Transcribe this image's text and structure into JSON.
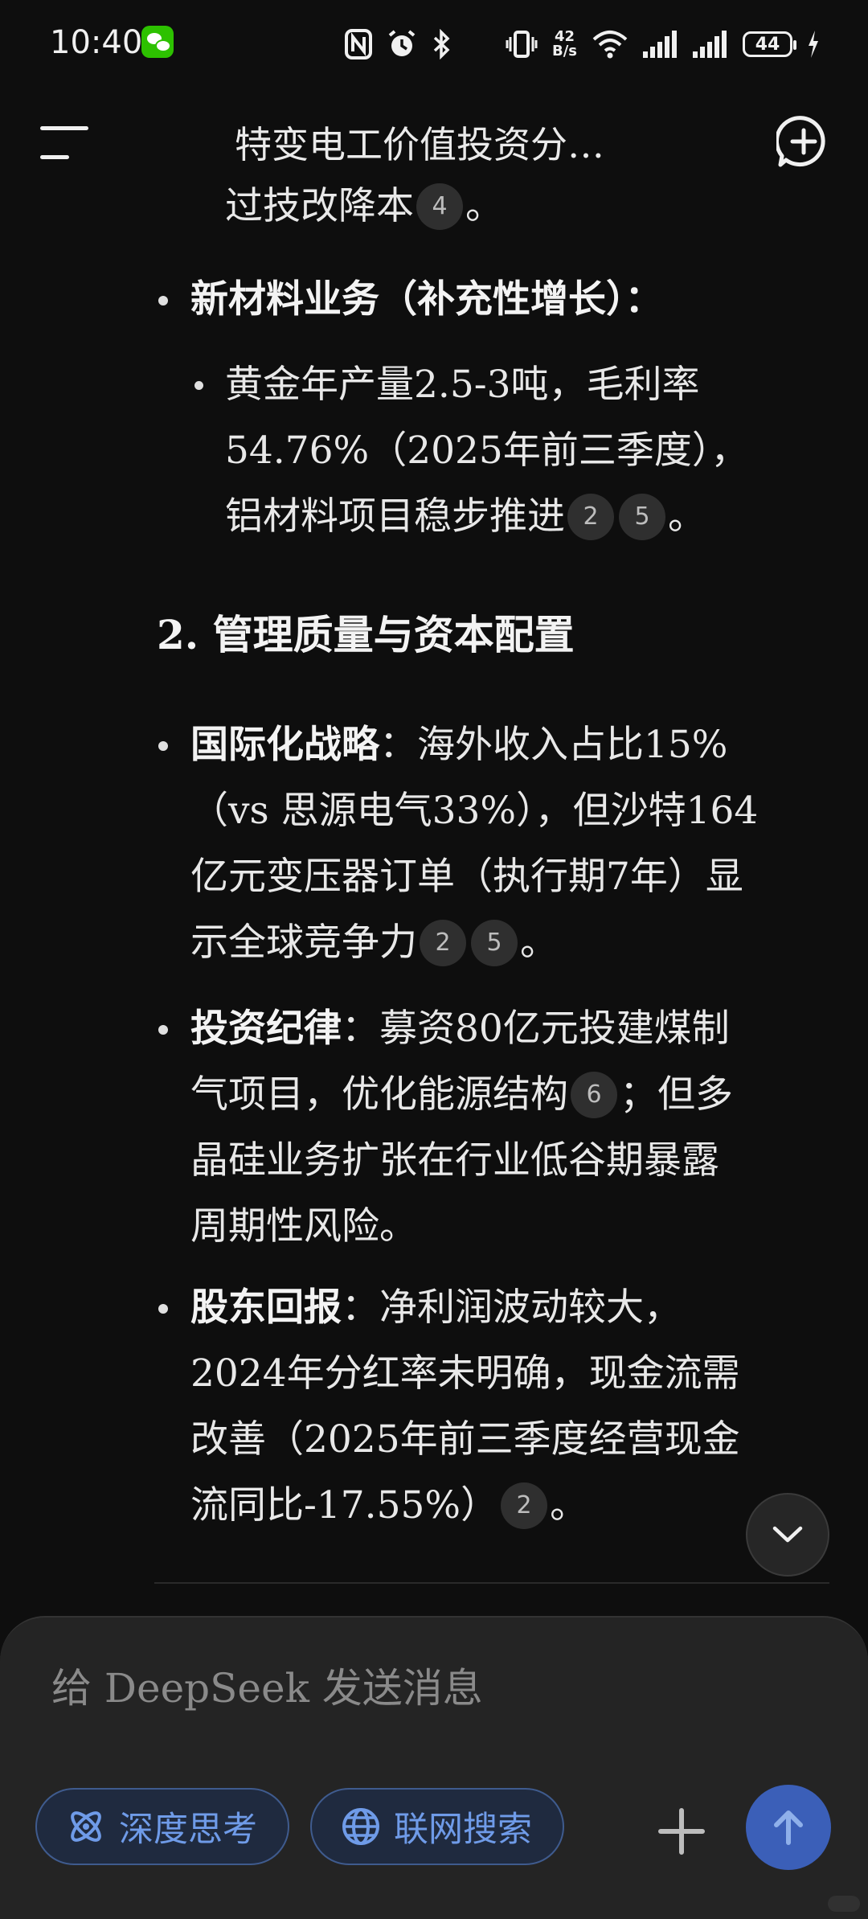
{
  "status_bar": {
    "time": "10:40",
    "net_speed_value": "42",
    "net_speed_unit": "B/s",
    "battery": "44"
  },
  "header": {
    "title": "特变电工价值投资分…"
  },
  "content": {
    "cont_line": "过技改降本",
    "cont_cites": [
      "4"
    ],
    "new_material": {
      "label": "新材料业务（补充性增长）：",
      "sub_lines": [
        "黄金年产量2.5-3吨，毛利率",
        "54.76%（2025年前三季度），",
        "铝材料项目稳步推进"
      ],
      "cites": [
        "2",
        "5"
      ]
    },
    "section_heading": "2. 管理质量与资本配置",
    "intl": {
      "label": "国际化战略",
      "lines": [
        "：海外收入占比15%",
        "（vs 思源电气33%），但沙特164",
        "亿元变压器订单（执行期7年）显",
        "示全球竞争力"
      ],
      "cites": [
        "2",
        "5"
      ]
    },
    "invest": {
      "label": "投资纪律",
      "lines": [
        "：募资80亿元投建煤制",
        "气项目，优化能源结构",
        "；但多",
        "晶硅业务扩张在行业低谷期暴露",
        "周期性风险。"
      ],
      "cites": [
        "6"
      ]
    },
    "holder": {
      "label": "股东回报",
      "lines": [
        "：净利润波动较大，",
        "2024年分红率未明确，现金流需",
        "改善（2025年前三季度经营现金",
        "流同比-17.55%）"
      ],
      "cites": [
        "2"
      ]
    },
    "period": "。"
  },
  "composer": {
    "placeholder": "给 DeepSeek 发送消息",
    "deep_think_label": "深度思考",
    "web_search_label": "联网搜索"
  },
  "colors": {
    "background": "#0e0e0e",
    "composer": "#242424",
    "chip_text": "#6f9be8",
    "send_button": "#3b5fb8"
  },
  "icons": [
    "wechat-icon",
    "nfc-icon",
    "alarm-icon",
    "bluetooth-icon",
    "vibrate-icon",
    "wifi-icon",
    "signal-icon",
    "battery-icon",
    "menu-icon",
    "new-chat-icon",
    "chevron-down-icon",
    "atom-icon",
    "globe-icon",
    "plus-icon",
    "arrow-up-icon"
  ]
}
